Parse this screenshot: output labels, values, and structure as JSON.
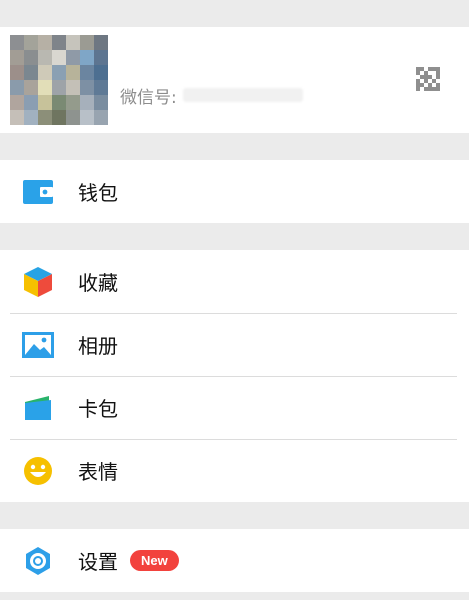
{
  "profile": {
    "nickname": "",
    "wechat_id_label": "微信号:",
    "wechat_id_value": "",
    "qr_icon": "qr-code-icon"
  },
  "menu": {
    "wallet": {
      "label": "钱包",
      "icon": "wallet-icon",
      "color": "#2aa2e8"
    },
    "favorites": {
      "label": "收藏",
      "icon": "cube-icon"
    },
    "album": {
      "label": "相册",
      "icon": "photo-album-icon",
      "color": "#2d9fe8"
    },
    "cards": {
      "label": "卡包",
      "icon": "card-wallet-icon"
    },
    "stickers": {
      "label": "表情",
      "icon": "smiley-icon",
      "color": "#f6c000"
    },
    "settings": {
      "label": "设置",
      "icon": "gear-icon",
      "badge": "New",
      "color": "#2d9fe8",
      "badge_color": "#f2423d"
    }
  }
}
